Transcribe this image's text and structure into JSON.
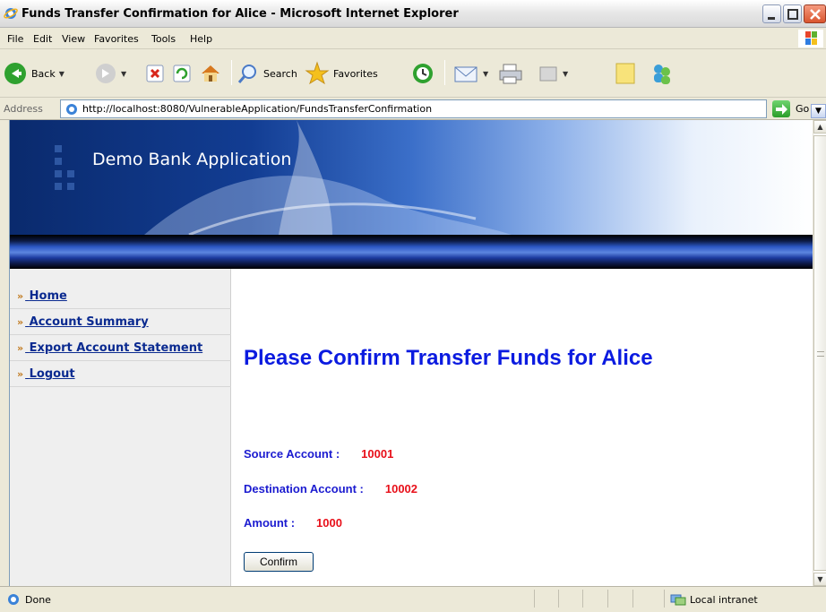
{
  "window": {
    "title": "Funds Transfer Confirmation for Alice - Microsoft Internet Explorer"
  },
  "menu": [
    "File",
    "Edit",
    "View",
    "Favorites",
    "Tools",
    "Help"
  ],
  "toolbar": {
    "back_label": "Back",
    "search_label": "Search",
    "favorites_label": "Favorites"
  },
  "address": {
    "label": "Address",
    "url": "http://localhost:8080/VulnerableApplication/FundsTransferConfirmation",
    "go_label": "Go"
  },
  "page": {
    "bank_title": "Demo Bank Application",
    "nav": [
      {
        "label": "Home"
      },
      {
        "label": "Account Summary"
      },
      {
        "label": "Export Account Statement"
      },
      {
        "label": "Logout"
      }
    ],
    "nav_chevron": "»",
    "heading": "Please Confirm Transfer Funds for Alice",
    "source_label": "Source Account :",
    "source_value": "10001",
    "destination_label": "Destination Account :",
    "destination_value": "10002",
    "amount_label": "Amount :",
    "amount_value": "1000",
    "confirm_label": "Confirm"
  },
  "status": {
    "text": "Done",
    "zone": "Local intranet"
  },
  "colors": {
    "heading": "#0b1be0",
    "field_label": "#1b1bd0",
    "field_value": "#e8101a",
    "nav_link": "#0a2a90"
  }
}
